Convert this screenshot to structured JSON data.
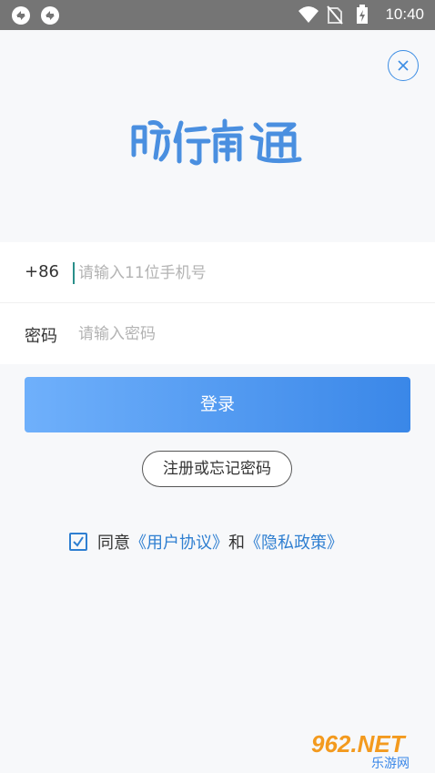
{
  "status_bar": {
    "time": "10:40",
    "icons": [
      "sync-icon",
      "sync-icon",
      "wifi-icon",
      "no-sim-icon",
      "battery-charging-icon"
    ]
  },
  "header": {
    "close_icon": "close-circle-icon",
    "logo_text": "畅行南通"
  },
  "login_form": {
    "country_code": "+86",
    "phone_placeholder": "请输入11位手机号",
    "phone_value": "",
    "password_label": "密码",
    "password_placeholder": "请输入密码",
    "password_value": ""
  },
  "actions": {
    "login_label": "登录",
    "register_label": "注册或忘记密码"
  },
  "agreement": {
    "checked": true,
    "prefix": "同意",
    "user_agreement": "《用户协议》",
    "and": "和",
    "privacy_policy": "《隐私政策》"
  },
  "colors": {
    "accent": "#3a87e8",
    "link": "#2f7fd1",
    "status_bar": "#757575",
    "button_gradient_start": "#6fb0fb",
    "button_gradient_end": "#3a87e8"
  },
  "watermark": {
    "brand": "962.NET",
    "subtitle": "乐游网"
  }
}
